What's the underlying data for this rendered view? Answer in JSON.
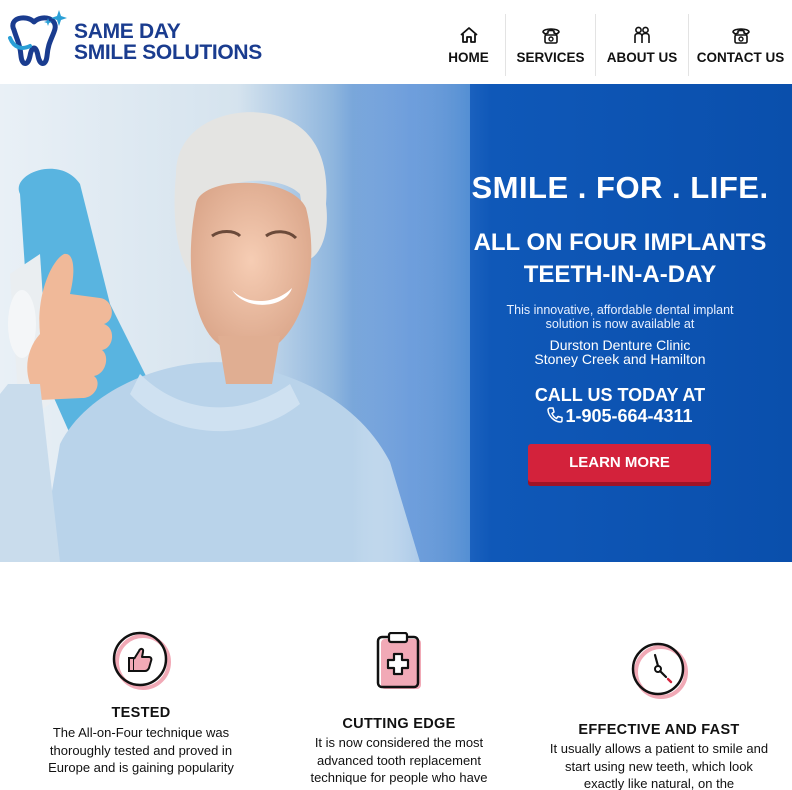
{
  "brand": {
    "line1": "SAME DAY",
    "line2": "SMILE SOLUTIONS",
    "logo_icon": "tooth-sparkle-icon",
    "colors": {
      "navy": "#1a3c8f",
      "teal": "#2a9fd6"
    }
  },
  "nav": {
    "items": [
      {
        "label": "HOME",
        "icon": "home-icon"
      },
      {
        "label": "SERVICES",
        "icon": "phone-icon"
      },
      {
        "label": "ABOUT US",
        "icon": "people-icon"
      },
      {
        "label": "CONTACT US",
        "icon": "phone-icon"
      }
    ]
  },
  "hero": {
    "slogan": "SMILE . FOR . LIFE.",
    "headline_line1": "ALL ON FOUR IMPLANTS",
    "headline_line2": "TEETH-IN-A-DAY",
    "intro": "This innovative, affordable dental implant solution is now available at",
    "clinic_line1": "Durston Denture Clinic",
    "clinic_line2": "Stoney Creek and Hamilton",
    "call_label": "CALL US TODAY AT",
    "phone": "1-905-664-4311",
    "cta_label": "LEARN MORE",
    "colors": {
      "background": "#0a4fac",
      "cta": "#d3223b"
    }
  },
  "features": [
    {
      "title": "TESTED",
      "icon": "thumbs-up-icon",
      "text": "The All-on-Four technique was thoroughly tested and proved in Europe and is gaining popularity"
    },
    {
      "title": "CUTTING EDGE",
      "icon": "clipboard-medical-icon",
      "text": "It is now considered the most advanced tooth replacement technique for people who have"
    },
    {
      "title": "EFFECTIVE AND FAST",
      "icon": "clock-icon",
      "text": "It usually allows a patient to smile and start using new teeth, which look exactly like natural, on the"
    }
  ]
}
